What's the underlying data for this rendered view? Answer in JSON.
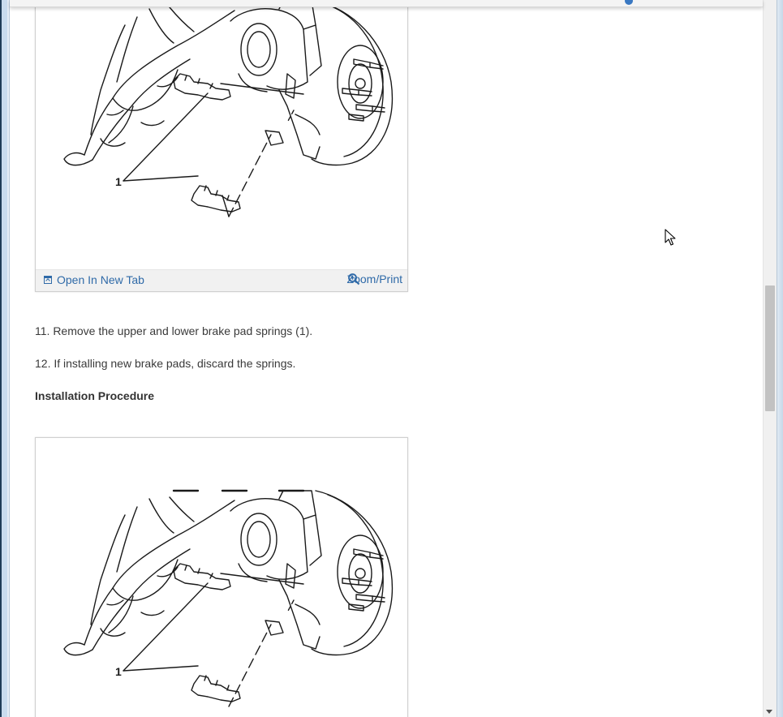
{
  "figure_top": {
    "callout": "1",
    "open_label": "Open In New Tab",
    "zoom_label": "Zoom/Print"
  },
  "steps": [
    "11. Remove the upper and lower brake pad springs (1).",
    "12. If installing new brake pads, discard the springs."
  ],
  "installation_heading": "Installation Procedure",
  "figure_bottom": {
    "callout": "1"
  },
  "icons": [
    "open-in-new-tab-icon",
    "magnifier-zoom-icon",
    "mouse-cursor-icon",
    "scroll-down-arrow-icon"
  ],
  "colors": {
    "link": "#2f6aa8",
    "text": "#3a3a3a",
    "toolbar_bg": "#f1f1f1",
    "scroll_thumb": "#c2c2c2"
  }
}
